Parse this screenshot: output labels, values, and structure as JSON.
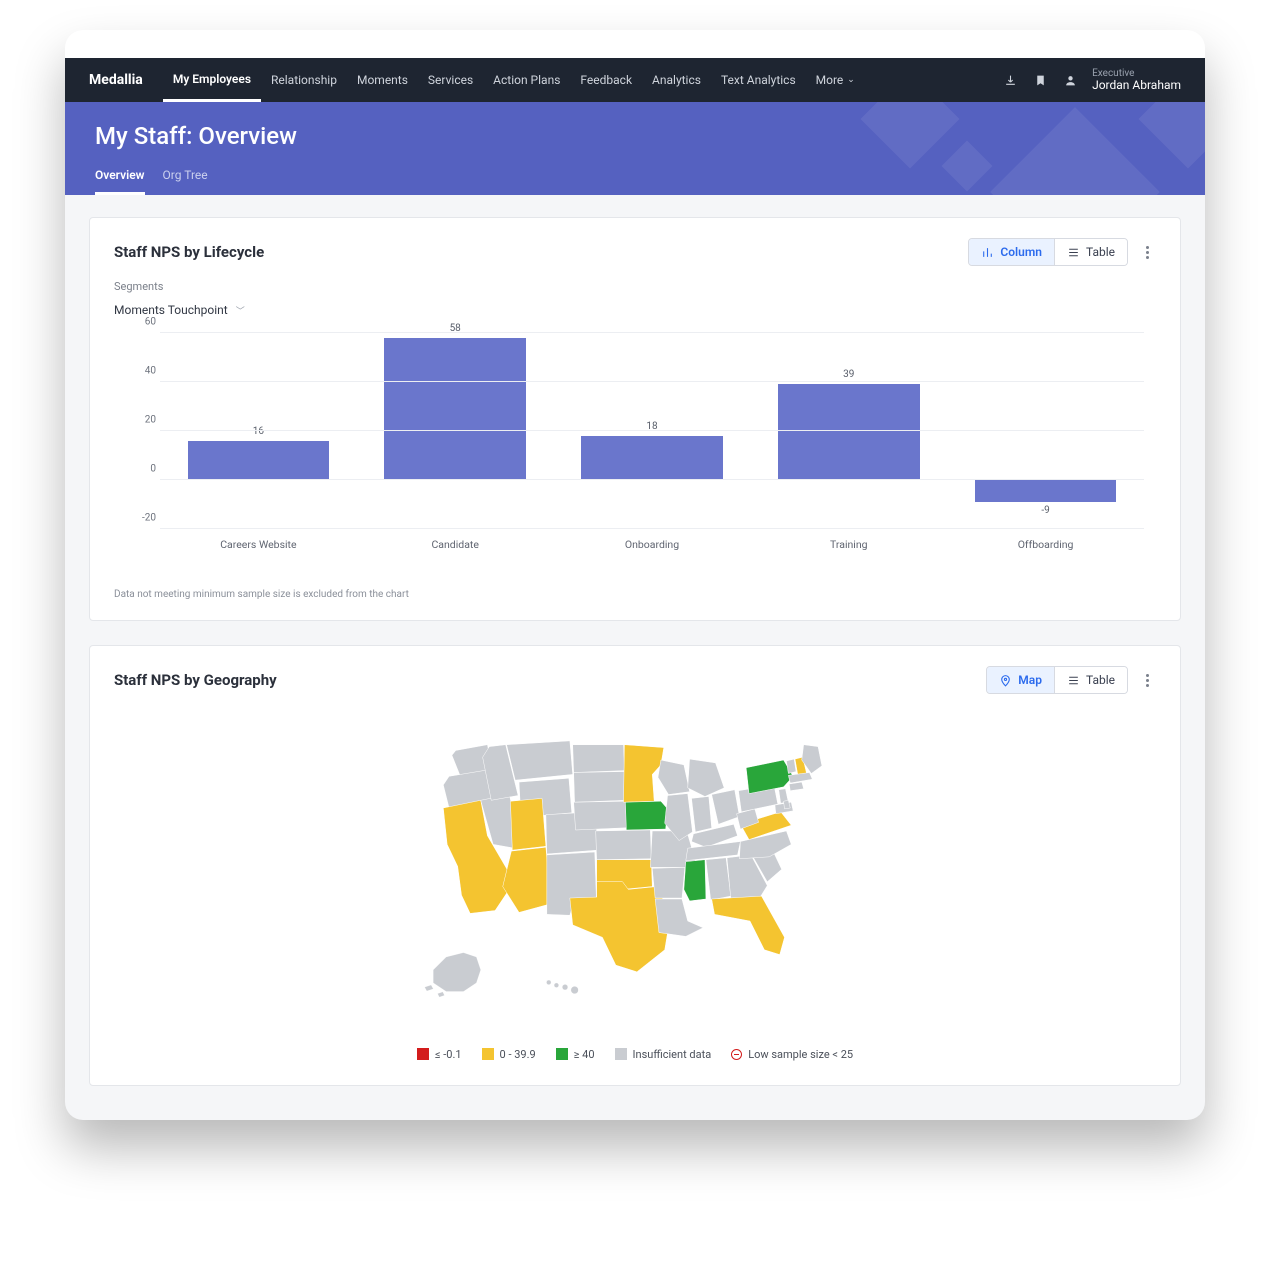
{
  "brand": "Medallia",
  "nav": {
    "items": [
      {
        "label": "My Employees",
        "active": true
      },
      {
        "label": "Relationship"
      },
      {
        "label": "Moments"
      },
      {
        "label": "Services"
      },
      {
        "label": "Action Plans"
      },
      {
        "label": "Feedback"
      },
      {
        "label": "Analytics"
      },
      {
        "label": "Text Analytics"
      },
      {
        "label": "More",
        "dropdown": true
      }
    ]
  },
  "user": {
    "role": "Executive",
    "name": "Jordan Abraham"
  },
  "banner": {
    "title": "My Staff: Overview",
    "tabs": [
      {
        "label": "Overview",
        "active": true
      },
      {
        "label": "Org Tree"
      }
    ]
  },
  "card1": {
    "title": "Staff NPS by Lifecycle",
    "toggles": {
      "primary": "Column",
      "secondary": "Table"
    },
    "segments_label": "Segments",
    "dropdown": "Moments Touchpoint",
    "footnote": "Data not meeting minimum sample size is excluded from the chart"
  },
  "chart_data": {
    "type": "bar",
    "title": "Staff NPS by Lifecycle",
    "xlabel": "",
    "ylabel": "",
    "categories": [
      "Careers Website",
      "Candidate",
      "Onboarding",
      "Training",
      "Offboarding"
    ],
    "values": [
      16,
      58,
      18,
      39,
      -9
    ],
    "ylim": [
      -20,
      60
    ],
    "yticks": [
      -20,
      0,
      20,
      40,
      60
    ]
  },
  "card2": {
    "title": "Staff NPS by Geography",
    "toggles": {
      "primary": "Map",
      "secondary": "Table"
    },
    "legend": [
      {
        "swatch": "red",
        "label": "≤ -0.1"
      },
      {
        "swatch": "yellow",
        "label": "0 - 39.9"
      },
      {
        "swatch": "green",
        "label": "≥ 40"
      },
      {
        "swatch": "gray",
        "label": "Insufficient data"
      },
      {
        "swatch": "low",
        "label": "Low sample size < 25"
      }
    ],
    "states_yellow": [
      "CA",
      "AZ",
      "UT",
      "TX",
      "OK",
      "MN",
      "FL",
      "VA",
      "NH"
    ],
    "states_green": [
      "IA",
      "MS",
      "NY"
    ]
  }
}
